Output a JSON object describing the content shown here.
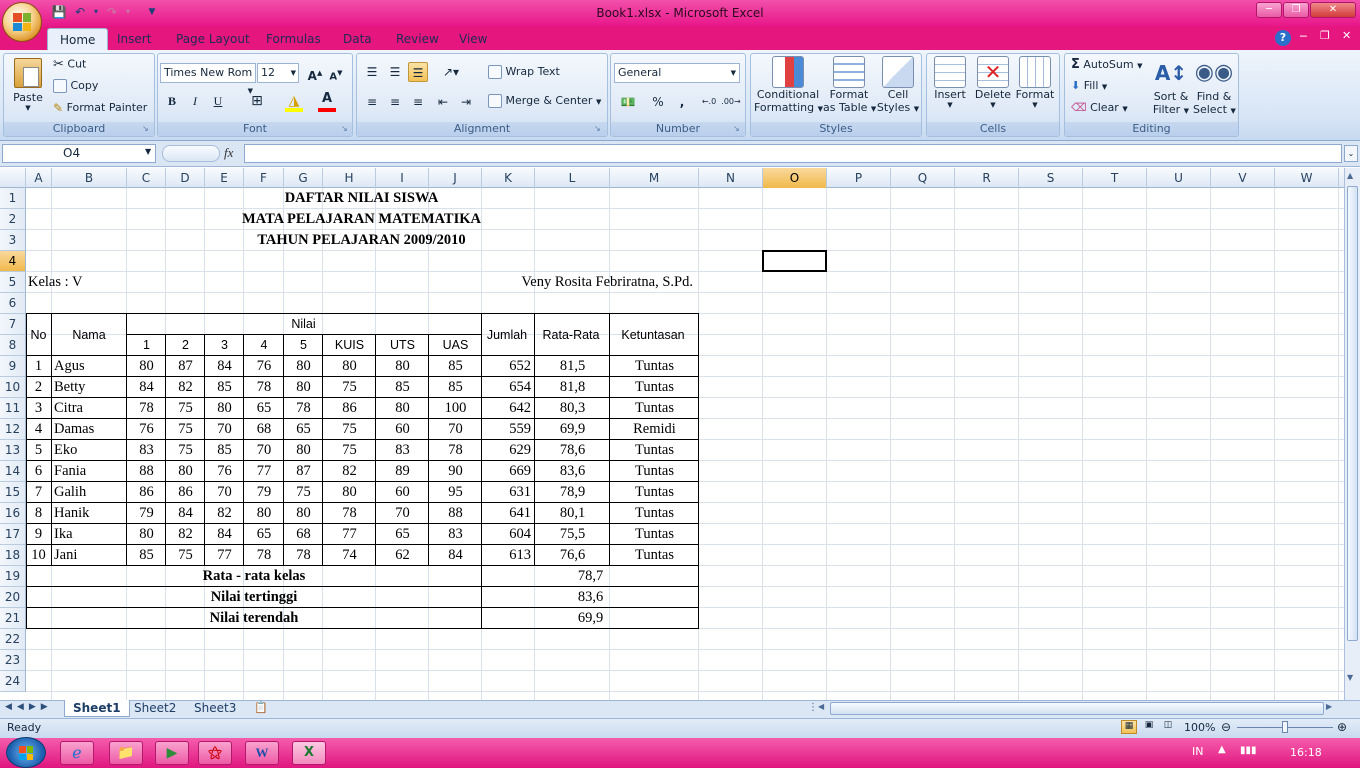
{
  "window": {
    "title": "Book1.xlsx - Microsoft Excel"
  },
  "ribbon": {
    "tabs": [
      "Home",
      "Insert",
      "Page Layout",
      "Formulas",
      "Data",
      "Review",
      "View"
    ],
    "active_tab": "Home",
    "clipboard": {
      "paste": "Paste",
      "cut": "Cut",
      "copy": "Copy",
      "format_painter": "Format Painter",
      "label": "Clipboard"
    },
    "font": {
      "name": "Times New Rom",
      "size": "12",
      "bold": "B",
      "italic": "I",
      "underline": "U",
      "label": "Font"
    },
    "alignment": {
      "wrap_text": "Wrap Text",
      "merge_center": "Merge & Center",
      "label": "Alignment"
    },
    "number": {
      "format": "General",
      "percent": "%",
      "comma": ",",
      "label": "Number"
    },
    "styles": {
      "conditional_1": "Conditional",
      "conditional_2": "Formatting",
      "format_table_1": "Format",
      "format_table_2": "as Table",
      "cell_styles_1": "Cell",
      "cell_styles_2": "Styles",
      "label": "Styles"
    },
    "cells": {
      "insert": "Insert",
      "delete": "Delete",
      "format": "Format",
      "label": "Cells"
    },
    "editing": {
      "autosum": "AutoSum",
      "fill": "Fill",
      "clear": "Clear",
      "sort_1": "Sort &",
      "sort_2": "Filter",
      "find_1": "Find &",
      "find_2": "Select",
      "label": "Editing"
    }
  },
  "formula_bar": {
    "name_box": "O4",
    "fx": "fx",
    "content": ""
  },
  "columns": [
    "A",
    "B",
    "C",
    "D",
    "E",
    "F",
    "G",
    "H",
    "I",
    "J",
    "K",
    "L",
    "M",
    "N",
    "O",
    "P",
    "Q",
    "R",
    "S",
    "T",
    "U",
    "V",
    "W"
  ],
  "selected_column": "O",
  "rows": [
    "1",
    "2",
    "3",
    "4",
    "5",
    "6",
    "7",
    "8",
    "9",
    "10",
    "11",
    "12",
    "13",
    "14",
    "15",
    "16",
    "17",
    "18",
    "19",
    "20",
    "21",
    "22",
    "23",
    "24"
  ],
  "selected_row": "4",
  "sheet": {
    "title1": "DAFTAR NILAI SISWA",
    "title2": "MATA PELAJARAN MATEMATIKA",
    "title3": "TAHUN PELAJARAN 2009/2010",
    "kelas": "Kelas : V",
    "teacher": "Veny Rosita Febriratna, S.Pd.",
    "headers": {
      "no": "No",
      "nama": "Nama",
      "nilai": "Nilai",
      "sub": [
        "1",
        "2",
        "3",
        "4",
        "5",
        "KUIS",
        "UTS",
        "UAS"
      ],
      "jumlah": "Jumlah",
      "rata": "Rata-Rata",
      "ketuntasan": "Ketuntasan"
    },
    "students": [
      {
        "no": "1",
        "nama": "Agus",
        "scores": [
          "80",
          "87",
          "84",
          "76",
          "80",
          "80",
          "80",
          "85"
        ],
        "jumlah": "652",
        "rata": "81,5",
        "ket": "Tuntas"
      },
      {
        "no": "2",
        "nama": "Betty",
        "scores": [
          "84",
          "82",
          "85",
          "78",
          "80",
          "75",
          "85",
          "85"
        ],
        "jumlah": "654",
        "rata": "81,8",
        "ket": "Tuntas"
      },
      {
        "no": "3",
        "nama": "Citra",
        "scores": [
          "78",
          "75",
          "80",
          "65",
          "78",
          "86",
          "80",
          "100"
        ],
        "jumlah": "642",
        "rata": "80,3",
        "ket": "Tuntas"
      },
      {
        "no": "4",
        "nama": "Damas",
        "scores": [
          "76",
          "75",
          "70",
          "68",
          "65",
          "75",
          "60",
          "70"
        ],
        "jumlah": "559",
        "rata": "69,9",
        "ket": "Remidi"
      },
      {
        "no": "5",
        "nama": "Eko",
        "scores": [
          "83",
          "75",
          "85",
          "70",
          "80",
          "75",
          "83",
          "78"
        ],
        "jumlah": "629",
        "rata": "78,6",
        "ket": "Tuntas"
      },
      {
        "no": "6",
        "nama": "Fania",
        "scores": [
          "88",
          "80",
          "76",
          "77",
          "87",
          "82",
          "89",
          "90"
        ],
        "jumlah": "669",
        "rata": "83,6",
        "ket": "Tuntas"
      },
      {
        "no": "7",
        "nama": "Galih",
        "scores": [
          "86",
          "86",
          "70",
          "79",
          "75",
          "80",
          "60",
          "95"
        ],
        "jumlah": "631",
        "rata": "78,9",
        "ket": "Tuntas"
      },
      {
        "no": "8",
        "nama": "Hanik",
        "scores": [
          "79",
          "84",
          "82",
          "80",
          "80",
          "78",
          "70",
          "88"
        ],
        "jumlah": "641",
        "rata": "80,1",
        "ket": "Tuntas"
      },
      {
        "no": "9",
        "nama": "Ika",
        "scores": [
          "80",
          "82",
          "84",
          "65",
          "68",
          "77",
          "65",
          "83"
        ],
        "jumlah": "604",
        "rata": "75,5",
        "ket": "Tuntas"
      },
      {
        "no": "10",
        "nama": "Jani",
        "scores": [
          "85",
          "75",
          "77",
          "78",
          "78",
          "74",
          "62",
          "84"
        ],
        "jumlah": "613",
        "rata": "76,6",
        "ket": "Tuntas"
      }
    ],
    "summary": [
      {
        "label": "Rata - rata kelas",
        "value": "78,7"
      },
      {
        "label": "Nilai tertinggi",
        "value": "83,6"
      },
      {
        "label": "Nilai terendah",
        "value": "69,9"
      }
    ]
  },
  "sheet_tabs": [
    "Sheet1",
    "Sheet2",
    "Sheet3"
  ],
  "active_sheet": "Sheet1",
  "status": {
    "ready": "Ready",
    "zoom": "100%"
  },
  "taskbar": {
    "lang": "IN",
    "time": "16:18"
  },
  "colors": {
    "title_pink": "#e8178a",
    "ribbon_blue": "#dfe9f6",
    "selection": "#f1b94b"
  }
}
